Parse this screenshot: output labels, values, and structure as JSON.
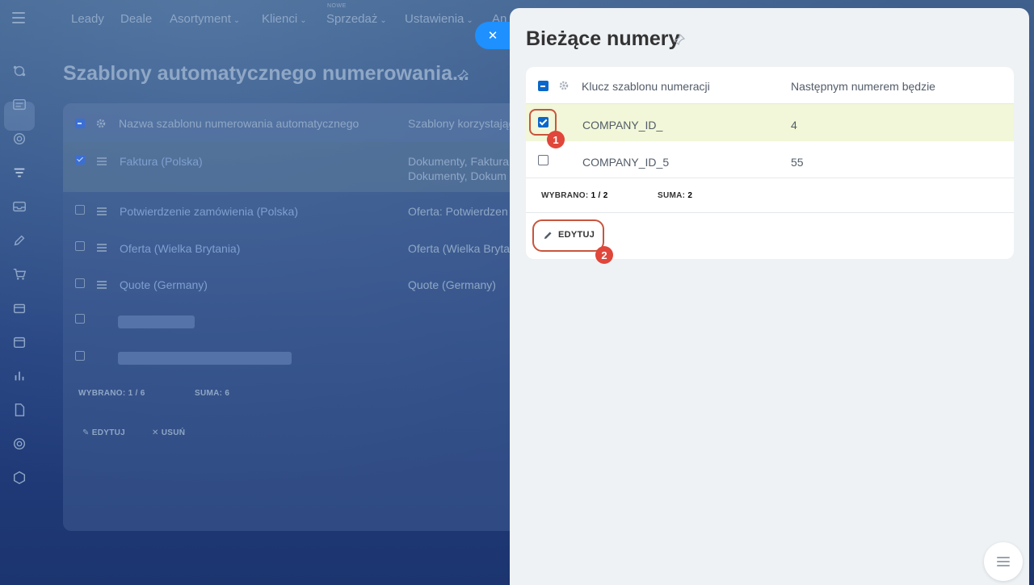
{
  "topnav": {
    "items": [
      {
        "label": "Leady",
        "chevron": false
      },
      {
        "label": "Deale",
        "chevron": false
      },
      {
        "label": "Asortyment",
        "chevron": true
      },
      {
        "label": "Klienci",
        "chevron": true
      },
      {
        "label": "Sprzedaż",
        "chevron": true
      },
      {
        "label": "Ustawienia",
        "chevron": true
      },
      {
        "label": "An",
        "chevron": false
      }
    ],
    "new_badge": "NOWE"
  },
  "sidebar": {
    "icons": [
      "crm-icon",
      "contact-card-icon",
      "target-icon",
      "filter-icon",
      "inbox-icon",
      "pen-icon",
      "cart-icon",
      "store-icon",
      "calendar-icon",
      "analytics-icon",
      "document-icon",
      "at-sign-icon",
      "cube-icon"
    ],
    "active_index": 3
  },
  "background_page": {
    "title": "Szablony automatycznego numerowania...",
    "columns": [
      "Nazwa szablonu numerowania automatycznego",
      "Szablony korzystając"
    ],
    "rows": [
      {
        "name": "Faktura (Polska)",
        "templates": "Dokumenty, Faktura",
        "templates2": "Dokumenty, Dokum",
        "checked": true
      },
      {
        "name": "Potwierdzenie zamówienia (Polska)",
        "templates": "Oferta: Potwierdzen",
        "checked": false
      },
      {
        "name": "Oferta (Wielka Brytania)",
        "templates": "Oferta (Wielka Bryta",
        "checked": false
      },
      {
        "name": "Quote (Germany)",
        "templates": "Quote (Germany)",
        "checked": false
      }
    ],
    "footer": {
      "selected_label": "WYBRANO:",
      "selected_value": "1 / 6",
      "total_label": "SUMA:",
      "total_value": "6"
    },
    "actions": {
      "edit": "EDYTUJ",
      "delete": "USUŃ"
    }
  },
  "panel": {
    "title": "Bieżące numery",
    "columns": {
      "key": "Klucz szablonu numeracji",
      "next": "Następnym numerem będzie"
    },
    "rows": [
      {
        "key": "COMPANY_ID_",
        "next": "4",
        "checked": true
      },
      {
        "key": "COMPANY_ID_5",
        "next": "55",
        "checked": false
      }
    ],
    "footer": {
      "selected_label": "WYBRANO:",
      "selected_value": "1 / 2",
      "total_label": "SUMA:",
      "total_value": "2"
    },
    "edit_button": "EDYTUJ"
  },
  "annotations": {
    "badge1": "1",
    "badge2": "2",
    "color": "#e0463a"
  },
  "colors": {
    "accent": "#0b67c9",
    "selected_row": "#f1f7d8",
    "close_button": "#1e90ff"
  }
}
